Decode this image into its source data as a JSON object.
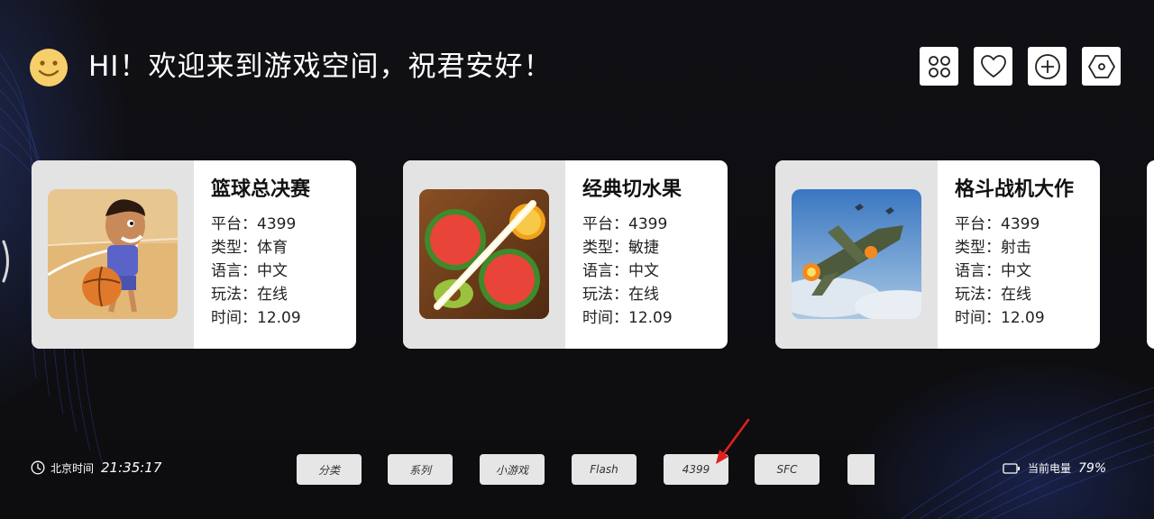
{
  "header": {
    "greeting": "HI！欢迎来到游戏空间，祝君安好！",
    "buttons": [
      {
        "icon": "grid-icon"
      },
      {
        "icon": "heart-icon"
      },
      {
        "icon": "plus-circle-icon"
      },
      {
        "icon": "hexagon-settings-icon"
      }
    ]
  },
  "cards": [
    {
      "title": "篮球总决赛",
      "thumb": "basketball-player-icon",
      "rows": [
        {
          "key": "平台：",
          "value": "4399"
        },
        {
          "key": "类型：",
          "value": "体育"
        },
        {
          "key": "语言：",
          "value": "中文"
        },
        {
          "key": "玩法：",
          "value": "在线"
        },
        {
          "key": "时间：",
          "value": "12.09"
        }
      ]
    },
    {
      "title": "经典切水果",
      "thumb": "sliced-fruit-icon",
      "rows": [
        {
          "key": "平台：",
          "value": "4399"
        },
        {
          "key": "类型：",
          "value": "敏捷"
        },
        {
          "key": "语言：",
          "value": "中文"
        },
        {
          "key": "玩法：",
          "value": "在线"
        },
        {
          "key": "时间：",
          "value": "12.09"
        }
      ]
    },
    {
      "title": "格斗战机大作",
      "thumb": "fighter-plane-icon",
      "rows": [
        {
          "key": "平台：",
          "value": "4399"
        },
        {
          "key": "类型：",
          "value": "射击"
        },
        {
          "key": "语言：",
          "value": "中文"
        },
        {
          "key": "玩法：",
          "value": "在线"
        },
        {
          "key": "时间：",
          "value": "12.09"
        }
      ]
    }
  ],
  "footer": {
    "clock_label": "北京时间",
    "clock_time": "21:35:17",
    "chips": [
      "分类",
      "系列",
      "小游戏",
      "Flash",
      "4399",
      "SFC",
      ""
    ],
    "battery_label": "当前电量",
    "battery_value": "79%"
  },
  "colors": {
    "background": "#0e0e11",
    "card": "#ffffff",
    "thumb_pane": "#e3e3e3",
    "chip": "#e6e6e6",
    "smiley": "#f6cf6a",
    "annotation_arrow": "#e02020"
  }
}
